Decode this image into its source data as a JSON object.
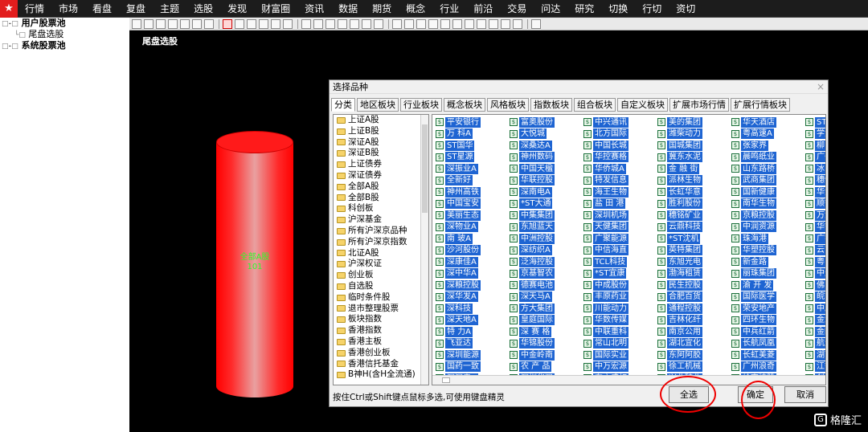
{
  "menubar": {
    "logo_glyph": "★",
    "items": [
      "行情",
      "市场",
      "看盘",
      "复盘",
      "主题",
      "选股",
      "发现",
      "财富圈",
      "资讯",
      "数据",
      "期货",
      "概念",
      "行业",
      "前沿",
      "交易",
      "问达",
      "研究",
      "切换",
      "行切",
      "资切"
    ]
  },
  "tree": {
    "items": [
      {
        "glyph": "□-□",
        "label": "用户股票池"
      },
      {
        "glyph": "└□",
        "label": "尾盘选股"
      },
      {
        "glyph": "□-□",
        "label": "系统股票池"
      }
    ]
  },
  "main": {
    "title": "尾盘选股",
    "cylinder_label_1": "全部A股",
    "cylinder_label_2": "101",
    "colors": {
      "cylinder": "#ff0000",
      "label": "#2bff2b"
    }
  },
  "dialog": {
    "title": "选择品种",
    "close_glyph": "×",
    "tabs": [
      "分类",
      "地区板块",
      "行业板块",
      "概念板块",
      "风格板块",
      "指数板块",
      "组合板块",
      "自定义板块",
      "扩展市场行情",
      "扩展行情板块"
    ],
    "categories": [
      "上证A股",
      "上证B股",
      "深证A股",
      "深证B股",
      "上证债券",
      "深证债券",
      "全部A股",
      "全部B股",
      "科创板",
      "沪深基金",
      "所有沪深京品种",
      "所有沪深京指数",
      "北证A股",
      "沪深权证",
      "创业板",
      "自选股",
      "临时条件股",
      "退市整理股票",
      "板块指数",
      "香港指数",
      "香港主板",
      "香港创业板",
      "香港信托基金",
      "B神H(含H全流通)"
    ],
    "stock_icon": "$",
    "stock_columns": [
      [
        "平安银行",
        "万 科A",
        "ST国华",
        "ST星源",
        "深振业A",
        "全新好",
        "神州高铁",
        "中国宝安",
        "美丽生态",
        "深物业A",
        "南 玻A",
        "沙河股份",
        "深康佳A",
        "深中华A",
        "深粮控股",
        "深华发A",
        "深科技",
        "深天地A",
        "特 力A",
        "飞亚达",
        "深圳能源",
        "国药一致",
        "深深房A"
      ],
      [
        "富奥股份",
        "大悦城",
        "深桑达A",
        "神州数码",
        "中国天楹",
        "华联控股",
        "深南电A",
        "*ST大通",
        "中集集团",
        "东旭蓝天",
        "中洲控股",
        "深纺织A",
        "泛海控股",
        "京基智农",
        "德赛电池",
        "深天马A",
        "方大集团",
        "皇庭国际",
        "深 赛 格",
        "华锦股份",
        "中金岭南",
        "农 产 品",
        "深圳华强"
      ],
      [
        "中兴通讯",
        "北方国际",
        "中国长城",
        "华控赛格",
        "华侨城A",
        "特发信息",
        "海王生物",
        "盐 田 港",
        "深圳机场",
        "天健集团",
        "广聚能源",
        "中信海直",
        "TCL科技",
        "*ST宜康",
        "中成股份",
        "丰原药业",
        "川能动力",
        "华数传媒",
        "中联重科",
        "常山北明",
        "国际实业",
        "中万宏源",
        "东方盛虹"
      ],
      [
        "美的集团",
        "潍柴动力",
        "国城集团",
        "冀东水泥",
        "金 融 街",
        "派林生物",
        "长虹华意",
        "胜利股份",
        "穗铭矿业",
        "云鼎科技",
        "*ST沈机",
        "英特集团",
        "东旭光电",
        "渤海租赁",
        "民生控股",
        "合肥百货",
        "通程控股",
        "吉林化纤",
        "南京公用",
        "湖北宜化",
        "东阿阿胶",
        "徐工机械",
        "兴业矿业"
      ],
      [
        "华天酒店",
        "粤高速A",
        "张家界",
        "晨鸣纸业",
        "山东路桥",
        "武商集团",
        "国新健康",
        "南华生物",
        "京粮控股",
        "中润资源",
        "珠海港",
        "华塑控股",
        "新金路",
        "丽珠集团",
        "渝 开 发",
        "国际医学",
        "荣安地产",
        "四环生物",
        "中兵红箭",
        "长航凤凰",
        "长虹美菱",
        "广州浪奇",
        "岭南控股"
      ],
      [
        "ST红",
        "学大",
        "柳",
        "广弘",
        "冰山",
        "穗恒",
        "华金",
        "顺钠",
        "万泽",
        "华铁",
        "广宇",
        "云南",
        "粤电",
        "中天",
        "佛山",
        "皖能",
        "中原",
        "金鸿",
        "金圆",
        "航天",
        "湖南",
        "江铃",
        "创元"
      ]
    ],
    "hint": "按住Ctrl或Shift键点鼠标多选,可使用键盘精灵",
    "select_all_label": "全选",
    "confirm_label": "确定",
    "cancel_label": "取消"
  },
  "watermark": {
    "text": "格隆汇",
    "glyph": "G"
  }
}
